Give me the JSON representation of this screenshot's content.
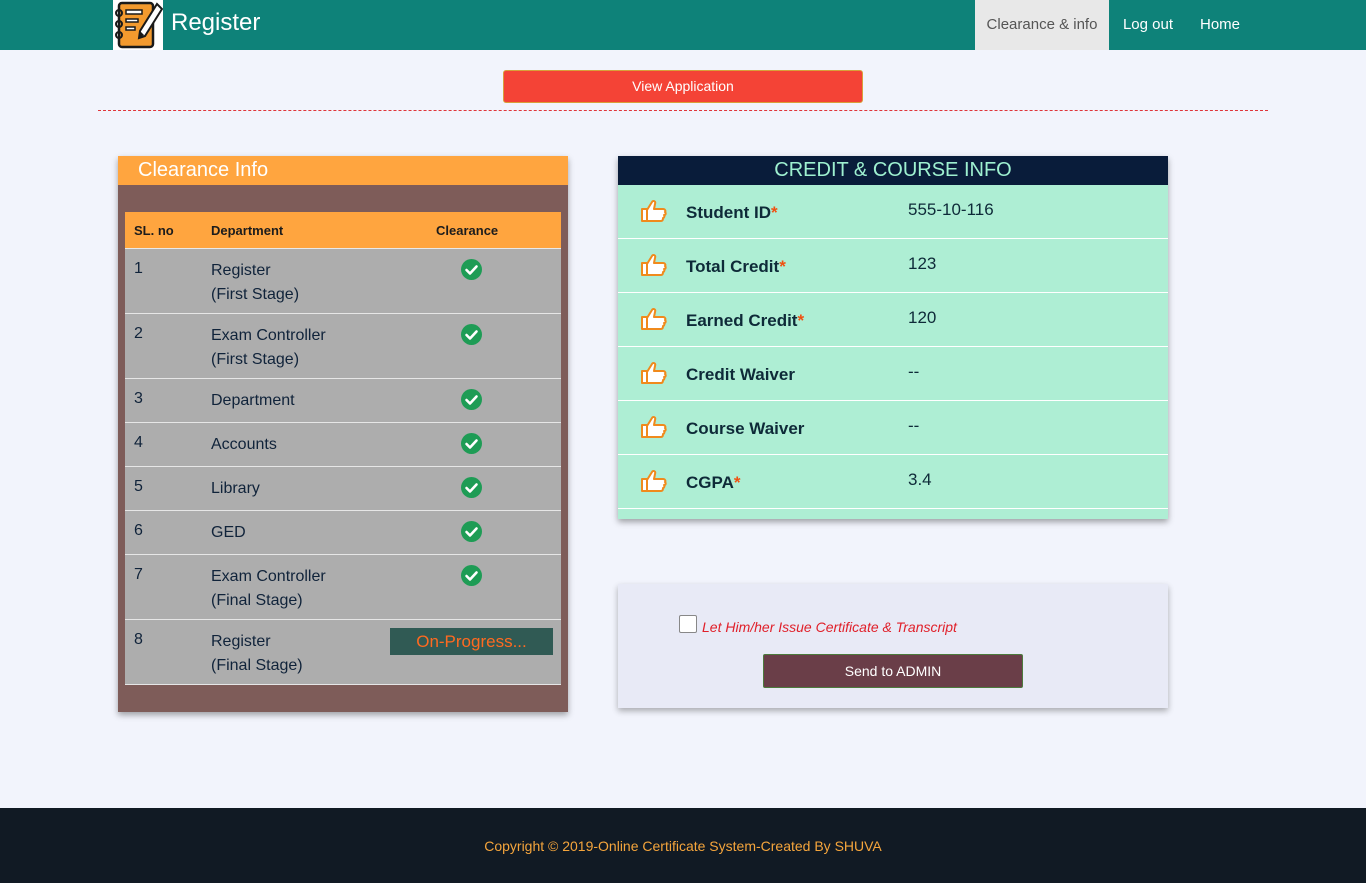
{
  "header": {
    "brand": "Register",
    "logo_icon": "notebook-pencil-icon",
    "nav": [
      {
        "label": "Clearance & info",
        "active": true
      },
      {
        "label": "Log out"
      },
      {
        "label": "Home"
      }
    ]
  },
  "actions": {
    "view_application": "View Application"
  },
  "clearance": {
    "title": "Clearance Info",
    "columns": [
      "SL. no",
      "Department",
      "Clearance"
    ],
    "rows": [
      {
        "sl": "1",
        "line1": "Register",
        "line2": "(First Stage)",
        "status": "cleared"
      },
      {
        "sl": "2",
        "line1": "Exam Controller",
        "line2": "(First Stage)",
        "status": "cleared"
      },
      {
        "sl": "3",
        "line1": "Department",
        "line2": "",
        "status": "cleared"
      },
      {
        "sl": "4",
        "line1": "Accounts",
        "line2": "",
        "status": "cleared"
      },
      {
        "sl": "5",
        "line1": "Library",
        "line2": "",
        "status": "cleared"
      },
      {
        "sl": "6",
        "line1": "GED",
        "line2": "",
        "status": "cleared"
      },
      {
        "sl": "7",
        "line1": "Exam Controller",
        "line2": "(Final Stage)",
        "status": "cleared"
      },
      {
        "sl": "8",
        "line1": "Register",
        "line2": "(Final Stage)",
        "status": "On-Progress..."
      }
    ]
  },
  "credit": {
    "title": "CREDIT & COURSE INFO",
    "row_icon": "thumbs-up-hand-icon",
    "rows": [
      {
        "label": "Student ID",
        "required": "*",
        "value": "555-10-116"
      },
      {
        "label": "Total Credit",
        "required": "*",
        "value": "123"
      },
      {
        "label": "Earned Credit",
        "required": "*",
        "value": "120"
      },
      {
        "label": "Credit Waiver",
        "required": "",
        "value": "--"
      },
      {
        "label": "Course Waiver",
        "required": "",
        "value": "--"
      },
      {
        "label": "CGPA",
        "required": "*",
        "value": "3.4"
      }
    ]
  },
  "admin": {
    "checkbox_label": "Let Him/her Issue Certificate & Transcript",
    "checked": false,
    "send_button": "Send to ADMIN"
  },
  "footer": {
    "text": "Copyright © 2019-Online Certificate System-Created By SHUVA"
  },
  "colors": {
    "navbar": "#0e8279",
    "accent_orange": "#ffa53f",
    "view_button": "#f44336",
    "credit_bg": "#aeeed4",
    "credit_header": "#091c3a",
    "check_green": "#1e9c55",
    "footer_bg": "#111a24",
    "footer_text": "#f5a53c"
  }
}
